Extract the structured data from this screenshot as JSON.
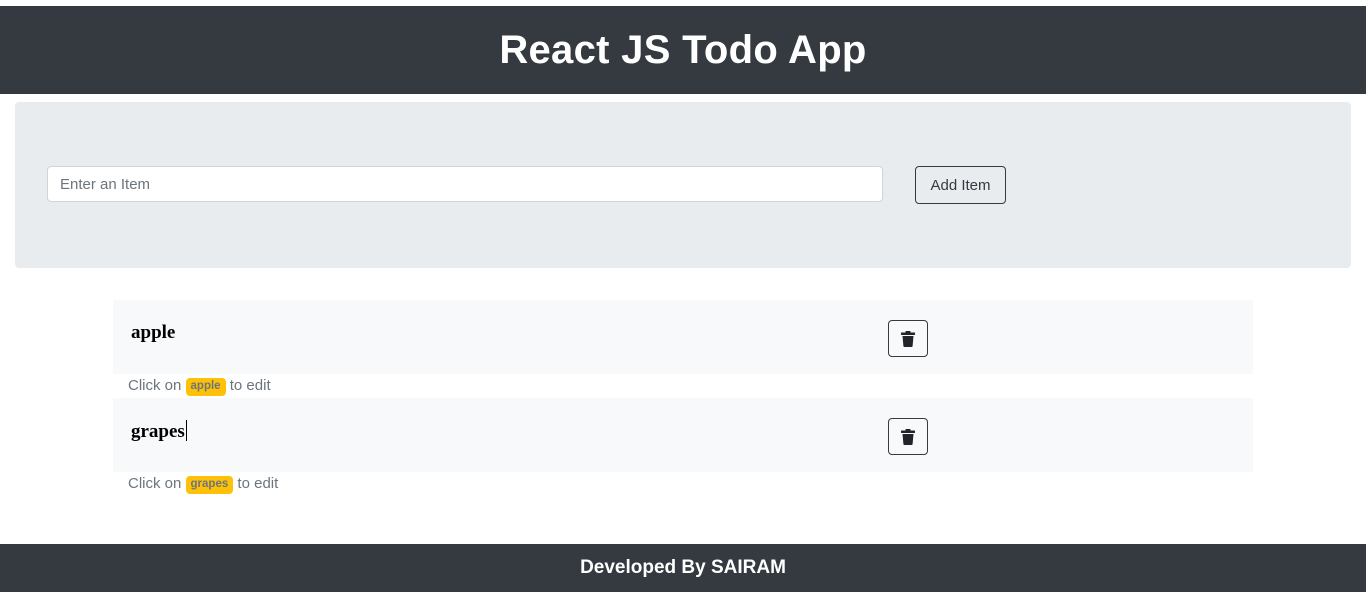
{
  "header": {
    "title": "React JS Todo App"
  },
  "form": {
    "input_placeholder": "Enter an Item",
    "input_value": "",
    "add_label": "Add Item"
  },
  "todos": [
    {
      "name": "apple",
      "hint_prefix": "Click on",
      "hint_badge": "apple",
      "hint_suffix": "to edit",
      "delete_icon": "trash-icon"
    },
    {
      "name": "grapes",
      "hint_prefix": "Click on",
      "hint_badge": "grapes",
      "hint_suffix": "to edit",
      "delete_icon": "trash-icon"
    }
  ],
  "footer": {
    "text": "Developed By SAIRAM"
  },
  "colors": {
    "dark": "#343a40",
    "jumbotron": "#e9ecef",
    "card": "#f8f9fa",
    "badge": "#ffc107",
    "muted": "#6c757d"
  }
}
